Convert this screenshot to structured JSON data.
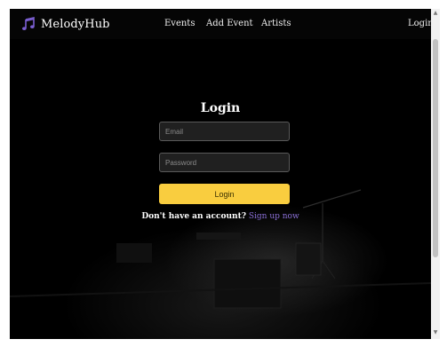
{
  "navbar": {
    "brand": "MelodyHub",
    "brand_icon": "music-note-icon",
    "links": {
      "events": "Events",
      "add_event": "Add Event",
      "artists": "Artists",
      "login": "Login"
    }
  },
  "login_form": {
    "title": "Login",
    "email_placeholder": "Email",
    "password_placeholder": "Password",
    "submit_label": "Login",
    "signup_prompt": "Don't have an account?",
    "signup_link": "Sign up now"
  },
  "colors": {
    "accent_button": "#f9cd3f",
    "link": "#8a6fd6",
    "brand_icon": "#7b5fd1",
    "background": "#000000"
  }
}
